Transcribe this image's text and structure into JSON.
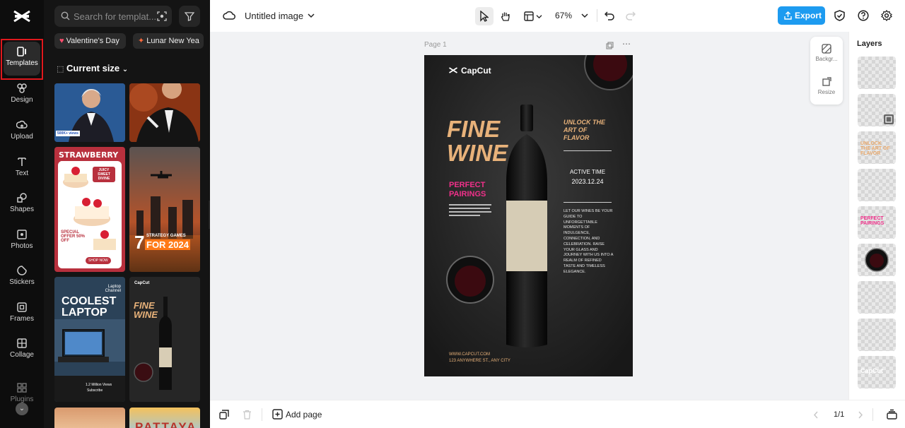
{
  "rail": {
    "items": [
      {
        "label": "Templates"
      },
      {
        "label": "Design"
      },
      {
        "label": "Upload"
      },
      {
        "label": "Text"
      },
      {
        "label": "Shapes"
      },
      {
        "label": "Photos"
      },
      {
        "label": "Stickers"
      },
      {
        "label": "Frames"
      },
      {
        "label": "Collage"
      },
      {
        "label": "Plugins"
      }
    ]
  },
  "panel": {
    "search_placeholder": "Search for templat...",
    "chips": [
      "Valentine's Day",
      "Lunar New Yea"
    ],
    "current_size": "Current size",
    "templates": [
      {
        "badge": "500K+ views"
      },
      {
        "title": "STRAWBERRY CAKE",
        "tag1": "JUICY SWEET DIVINE",
        "offer": "SPECIAL OFFER 50% OFF",
        "cta": "SHOP NOW"
      },
      {
        "number": "7",
        "title": "STRATEGY GAMES",
        "year": "FOR 2024"
      },
      {
        "kicker": "Laptop Channel",
        "title": "COOLEST LAPTOP",
        "views": "1.2 Million Views",
        "sub": "Subscribe"
      },
      {
        "brand": "CapCut",
        "title": "FINE WINE"
      },
      {
        "title": "PATTAYA"
      }
    ]
  },
  "topbar": {
    "title": "Untitled image",
    "zoom": "67%",
    "export": "Export"
  },
  "canvas": {
    "page_label": "Page 1",
    "side_tools": [
      {
        "label": "Backgr..."
      },
      {
        "label": "Resize"
      }
    ]
  },
  "poster": {
    "brand": "CapCut",
    "headline": "FINE WINE",
    "unlock": "UNLOCK THE ART OF FLAVOR",
    "active_label": "ACTIVE TIME",
    "active_date": "2023.12.24",
    "pairings": "PERFECT PAIRINGS",
    "body": "LET OUR WINES BE YOUR GUIDE TO UNFORGETTABLE MOMENTS OF INDULGENCE, CONNECTION, AND CELEBRATION. RAISE YOUR GLASS AND JOURNEY WITH US INTO A REALM OF REFINED TASTE AND TIMELESS ELEGANCE.",
    "url": "WWW.CAPCUT.COM",
    "address": "123 ANYWHERE ST., ANY CITY"
  },
  "layers": {
    "title": "Layers",
    "items": [
      "",
      "",
      "UNLOCK THE ART OF FLAVOR",
      "",
      "PERFECT PAIRINGS",
      "",
      "",
      "",
      "CapCut"
    ]
  },
  "bottombar": {
    "add_page": "Add page",
    "page_indicator": "1/1"
  },
  "colors": {
    "accent_blue": "#1d9bf0",
    "selection_red": "#e0181d",
    "poster_gold": "#e8b27a",
    "poster_pink": "#f0308a"
  }
}
